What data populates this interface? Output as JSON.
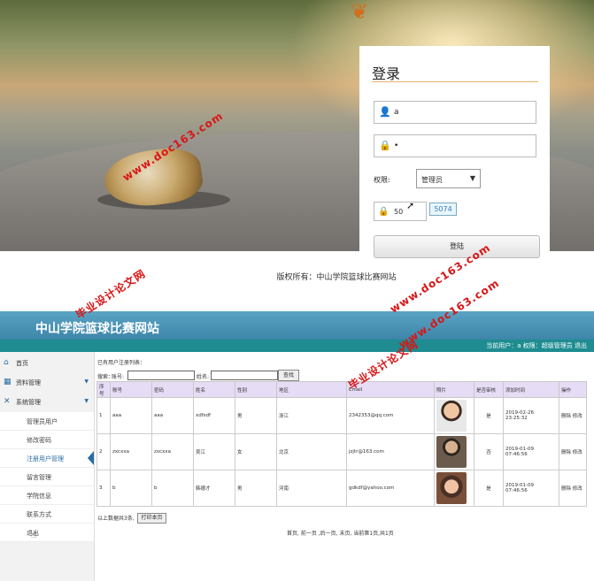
{
  "login": {
    "title": "登录",
    "username_value": "a",
    "password_value": "•",
    "role_label": "权限:",
    "role_selected": "管理员",
    "captcha_value": "50",
    "captcha_code": "5074",
    "login_button": "登陆",
    "copyright": "版权所有：中山学院篮球比赛网站"
  },
  "admin": {
    "site_title": "中山学院篮球比赛网站",
    "user_bar": "当前用户：a  权限：超级管理员  退出",
    "sidebar": {
      "home": "首页",
      "data_mgmt": "资料管理",
      "system_mgmt": "系统管理",
      "sub_items": [
        "管理员用户",
        "修改密码",
        "注册用户管理",
        "留言管理",
        "学院信息",
        "联系方式",
        "退出"
      ]
    },
    "list_caption": "已有用户注册列表：",
    "search": {
      "search_label": "搜索：",
      "account_label": "账号:",
      "name_label": "姓名:",
      "button": "查找"
    },
    "table": {
      "headers": [
        "序号",
        "账号",
        "密码",
        "姓名",
        "性别",
        "地区",
        "Email",
        "照片",
        "是否审核",
        "添加时间",
        "操作"
      ],
      "rows": [
        {
          "no": "1",
          "account": "aaa",
          "password": "aaa",
          "name": "xdfsdf",
          "gender": "男",
          "region": "浙江",
          "email": "2342353@qq.com",
          "approved": "是",
          "time": "2019-02-26 23:25:32",
          "ops": "删除 修改"
        },
        {
          "no": "2",
          "account": "zxcxxa",
          "password": "zxcxxa",
          "name": "吴江",
          "gender": "女",
          "region": "北京",
          "email": "jzjtr@163.com",
          "approved": "否",
          "time": "2019-01-09 07:46:56",
          "ops": "删除 修改"
        },
        {
          "no": "3",
          "account": "b",
          "password": "b",
          "name": "韩德才",
          "gender": "男",
          "region": "河南",
          "email": "gdkdf@yahoo.com",
          "approved": "是",
          "time": "2019-01-09 07:46:56",
          "ops": "删除 修改"
        }
      ]
    },
    "total_text": "以上数据共3条,",
    "print_button": "打印本页",
    "pager": "首页, 前一页 ,后一页, 末页, 当前第1页,共1页"
  },
  "watermarks": {
    "w1a": "毕业设计论文网",
    "w1b": "www.doc163.com",
    "w2a": "毕业设计论文网",
    "w2b": "www.doc163.com",
    "w3b": "www.doc163.com"
  }
}
